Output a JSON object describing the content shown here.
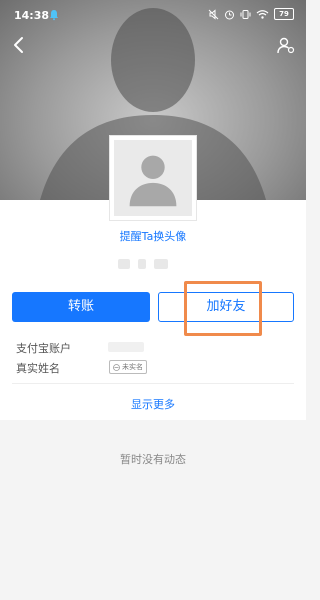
{
  "status_bar": {
    "time": "14:38",
    "battery": "79",
    "icons": [
      "notification-bell-icon",
      "mute-icon",
      "alarm-icon",
      "vibrate-icon",
      "wifi-icon",
      "battery-icon"
    ]
  },
  "nav": {
    "back_icon": "back-chevron-icon",
    "profile_icon": "user-settings-icon"
  },
  "profile": {
    "remind_avatar_link": "提醒Ta换头像"
  },
  "actions": {
    "transfer_label": "转账",
    "add_friend_label": "加好友"
  },
  "info": {
    "alipay_account_label": "支付宝账户",
    "real_name_label": "真实姓名",
    "unverified_badge": "未实名",
    "show_more": "显示更多"
  },
  "feed": {
    "empty_text": "暂时没有动态"
  },
  "colors": {
    "accent": "#1677ff",
    "highlight": "#f08a4b"
  }
}
